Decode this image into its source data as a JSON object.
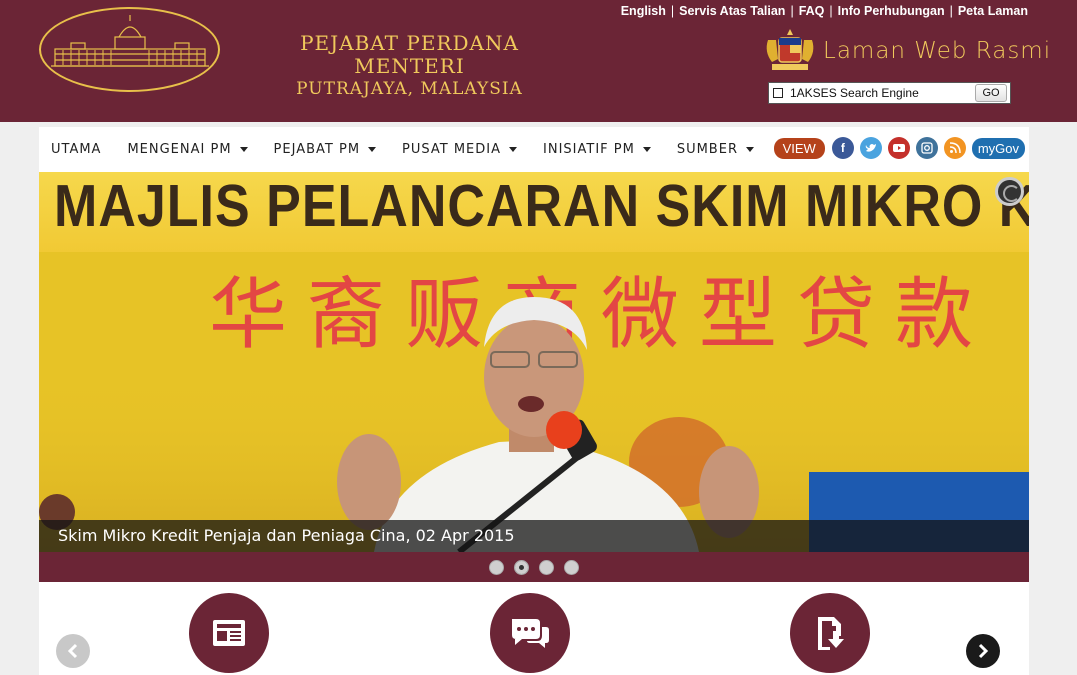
{
  "header": {
    "title_line1": "PEJABAT PERDANA MENTERI",
    "title_line2": "PUTRAJAYA, MALAYSIA",
    "laman": "Laman Web Rasmi",
    "toplinks": [
      "English",
      "Servis Atas Talian",
      "FAQ",
      "Info Perhubungan",
      "Peta Laman"
    ],
    "search_placeholder": "1AKSES Search Engine",
    "go_label": "GO"
  },
  "nav": {
    "items": [
      {
        "label": "UTAMA",
        "dropdown": false
      },
      {
        "label": "MENGENAI PM",
        "dropdown": true
      },
      {
        "label": "PEJABAT PM",
        "dropdown": true
      },
      {
        "label": "PUSAT MEDIA",
        "dropdown": true
      },
      {
        "label": "INISIATIF PM",
        "dropdown": true
      },
      {
        "label": "SUMBER",
        "dropdown": true
      }
    ],
    "view_label": "VIEW",
    "mygov_label": "myGov"
  },
  "slider": {
    "banner_text": "MAJLIS PELANCARAN SKIM MIKRO KREDIT",
    "chinese_text": "华裔贩商微型贷款",
    "caption": "Skim Mikro Kredit Penjaja dan Peniaga Cina, 02 Apr 2015",
    "slide_count": 4,
    "active_slide": 2
  },
  "colors": {
    "brand": "#6b2536",
    "gold": "#f0c95c"
  }
}
